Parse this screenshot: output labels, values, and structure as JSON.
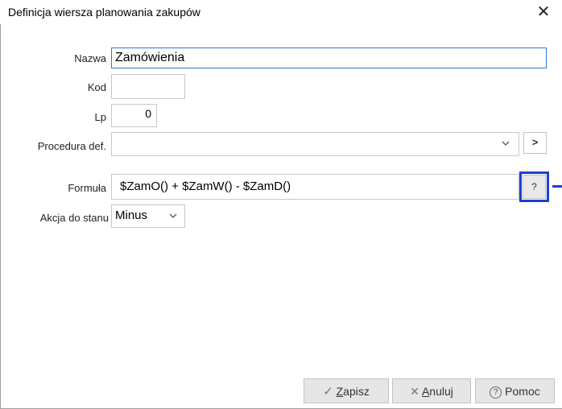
{
  "window": {
    "title": "Definicja wiersza planowania zakupów",
    "close_symbol": "✕"
  },
  "form": {
    "nazwa_label": "Nazwa",
    "nazwa_value": "Zamówienia",
    "kod_label": "Kod",
    "kod_value": "",
    "lp_label": "Lp",
    "lp_value": "0",
    "procedura_label": "Procedura def.",
    "procedura_value": "",
    "procedura_go": ">",
    "formula_label": "Formuła",
    "formula_value": "$ZamO() + $ZamW() - $ZamD()",
    "formula_help": "?",
    "akcja_label": "Akcja do stanu",
    "akcja_value": "Minus"
  },
  "buttons": {
    "zapisz_icon": "✓",
    "zapisz_underlined": "Z",
    "zapisz_rest": "apisz",
    "anuluj_icon": "✕",
    "anuluj_underlined": "A",
    "anuluj_rest": "nuluj",
    "pomoc_icon": "?",
    "pomoc_label": "Pomoc"
  },
  "colors": {
    "highlight": "#1a3fd6",
    "active_border": "#2b7bd4"
  }
}
